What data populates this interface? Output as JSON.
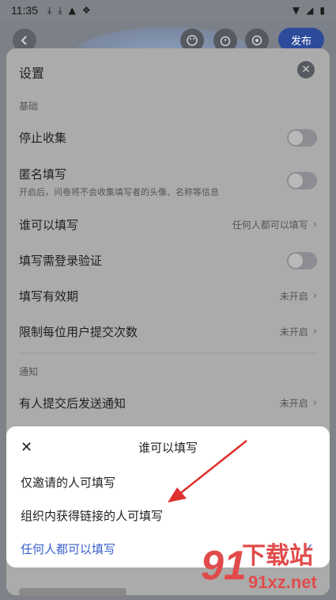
{
  "statusbar": {
    "time": "11:35",
    "icons": [
      "download-icon",
      "download-icon",
      "drive-icon",
      "bird-icon"
    ],
    "right_icons": [
      "wifi-icon",
      "signal-icon",
      "battery-icon"
    ]
  },
  "toolbar": {
    "publish_label": "发布"
  },
  "settings": {
    "title": "设置",
    "section_basic": "基础",
    "stop_collect": "停止收集",
    "anonymous": "匿名填写",
    "anonymous_sub": "开启后，问卷将不会收集填写者的头像、名称等信息",
    "who_can_fill": "谁可以填写",
    "who_can_fill_value": "任何人都可以填写",
    "login_required": "填写需登录验证",
    "validity": "填写有效期",
    "validity_value": "未开启",
    "limit_submit": "限制每位用户提交次数",
    "limit_submit_value": "未开启",
    "section_notify": "通知",
    "notify_submit": "有人提交后发送通知",
    "notify_submit_value": "未开启"
  },
  "popup": {
    "title": "谁可以填写",
    "options": [
      "仅邀请的人可填写",
      "组织内获得链接的人可填写",
      "任何人都可以填写"
    ],
    "selected_index": 2
  },
  "watermark": {
    "logo": "91",
    "text": "下载站",
    "url": "91xz.net"
  },
  "colors": {
    "accent": "#3a5fcc",
    "arrow": "#e0302e"
  }
}
